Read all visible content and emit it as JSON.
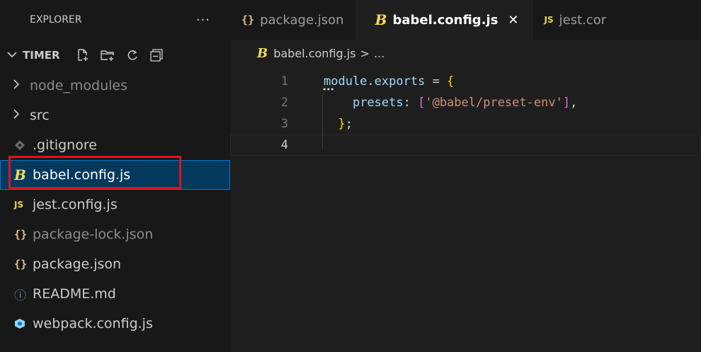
{
  "sidebar": {
    "title": "EXPLORER",
    "more_label": "···",
    "folder": {
      "name": "TIMER",
      "actions": [
        "new-file-icon",
        "new-folder-icon",
        "refresh-icon",
        "collapse-all-icon"
      ]
    },
    "items": [
      {
        "label": "node_modules",
        "kind": "folder",
        "icon": "chevron-right-icon",
        "dim": true
      },
      {
        "label": "src",
        "kind": "folder",
        "icon": "chevron-right-icon",
        "dim": false
      },
      {
        "label": ".gitignore",
        "kind": "file",
        "icon": "git-diamond-icon",
        "dim": false
      },
      {
        "label": "babel.config.js",
        "kind": "file",
        "icon": "babel-icon",
        "dim": false,
        "selected": true
      },
      {
        "label": "jest.config.js",
        "kind": "file",
        "icon": "js-icon",
        "icon_text": "JS",
        "dim": false
      },
      {
        "label": "package-lock.json",
        "kind": "file",
        "icon": "json-braces-icon",
        "icon_text": "{}",
        "dim": true
      },
      {
        "label": "package.json",
        "kind": "file",
        "icon": "json-braces-icon",
        "icon_text": "{}",
        "dim": false
      },
      {
        "label": "README.md",
        "kind": "file",
        "icon": "info-icon",
        "icon_text": "ⓘ",
        "dim": false
      },
      {
        "label": "webpack.config.js",
        "kind": "file",
        "icon": "webpack-cube-icon",
        "dim": false
      }
    ]
  },
  "tabs": [
    {
      "label": "package.json",
      "icon": "json-braces-icon",
      "icon_text": "{}",
      "active": false
    },
    {
      "label": "babel.config.js",
      "icon": "babel-icon",
      "icon_text": "B",
      "active": true,
      "close": "✕"
    },
    {
      "label": "jest.cor",
      "icon": "js-icon",
      "icon_text": "JS",
      "active": false
    }
  ],
  "breadcrumb": {
    "file": "babel.config.js",
    "separator": ">",
    "rest": "..."
  },
  "editor": {
    "lines": [
      {
        "num": "1",
        "tokens": [
          [
            "module",
            "k-var"
          ],
          [
            ".",
            "k-op"
          ],
          [
            "exports",
            "k-var"
          ],
          [
            " = ",
            "k-op"
          ],
          [
            "{",
            "k-brace"
          ]
        ]
      },
      {
        "num": "2",
        "tokens": [
          [
            "    ",
            "k-op"
          ],
          [
            "presets",
            "k-var"
          ],
          [
            ": ",
            "k-op"
          ],
          [
            "[",
            "k-bracket"
          ],
          [
            "'@babel/preset-env'",
            "k-str"
          ],
          [
            "]",
            "k-bracket"
          ],
          [
            ",",
            "k-op"
          ]
        ]
      },
      {
        "num": "3",
        "tokens": [
          [
            "  ",
            "k-op"
          ],
          [
            "}",
            "k-brace"
          ],
          [
            ";",
            "k-op"
          ]
        ]
      },
      {
        "num": "4",
        "tokens": []
      }
    ],
    "current_line": "4"
  },
  "colors": {
    "selection": "#04395e",
    "highlight_box": "#e0111d",
    "babel_yellow": "#f5da55"
  }
}
